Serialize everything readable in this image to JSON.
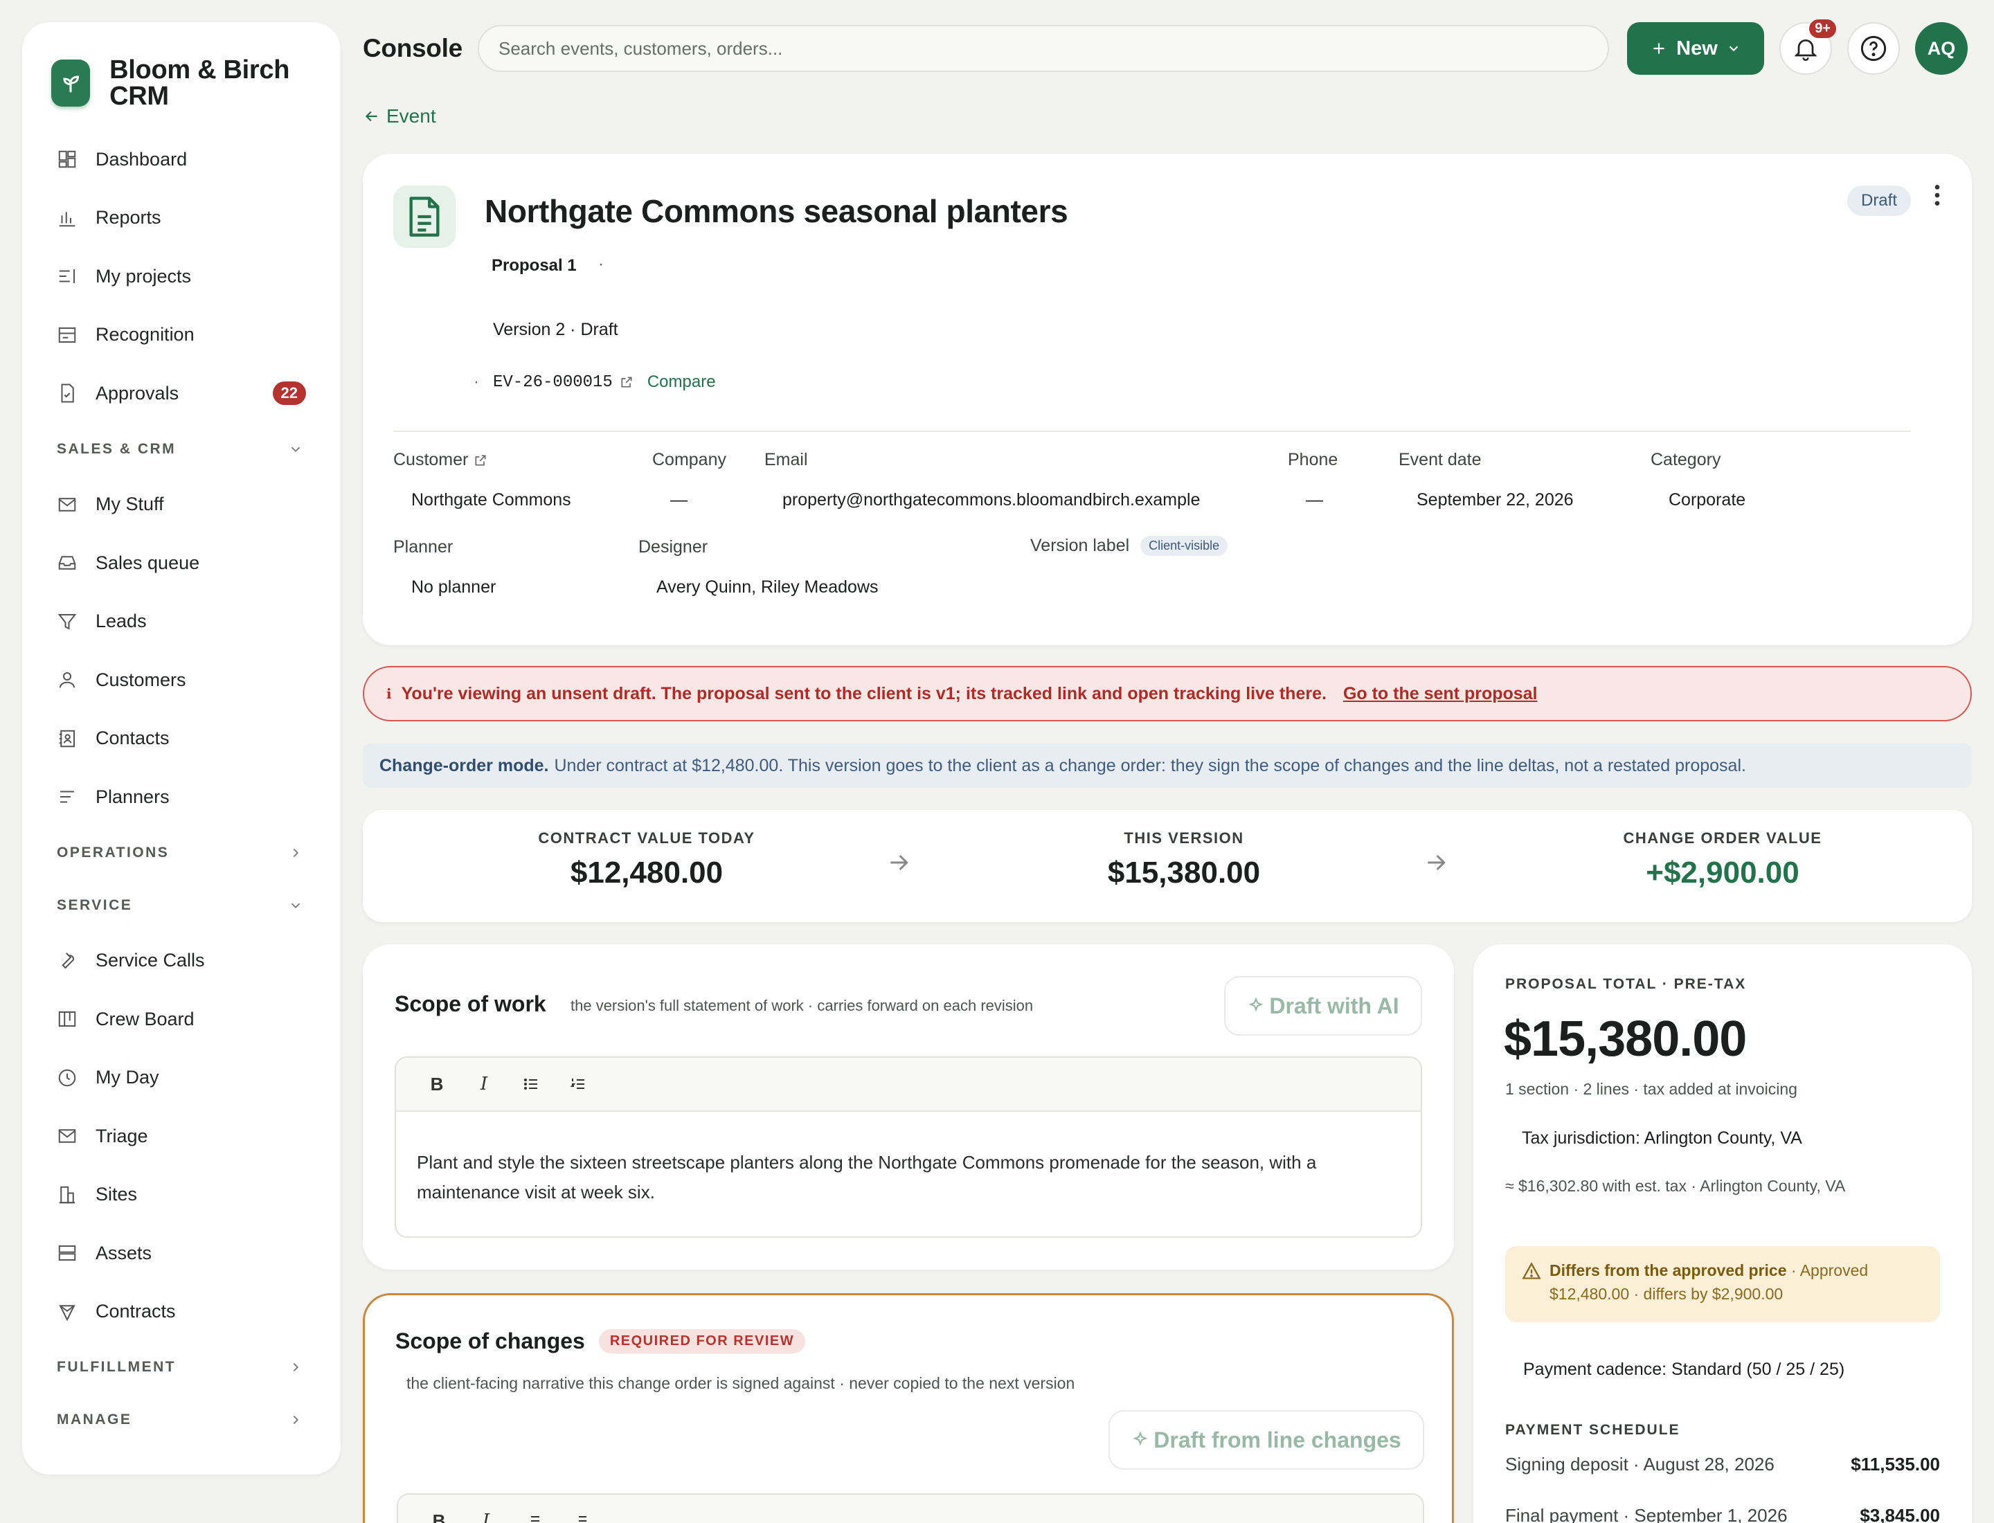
{
  "brand": {
    "name": "Bloom & Birch CRM",
    "logo_icon": "sprout-icon",
    "accent": "#22724b"
  },
  "sidebar": {
    "top_items": [
      {
        "label": "Dashboard",
        "icon": "dashboard-icon"
      },
      {
        "label": "Reports",
        "icon": "bar-chart-icon"
      },
      {
        "label": "My projects",
        "icon": "list-icon"
      },
      {
        "label": "Recognition",
        "icon": "card-icon"
      },
      {
        "label": "Approvals",
        "icon": "document-check-icon",
        "badge": "22"
      }
    ],
    "sales_section": "SALES & CRM",
    "sales_items": [
      {
        "label": "My Stuff",
        "icon": "mail-icon"
      },
      {
        "label": "Sales queue",
        "icon": "inbox-icon"
      },
      {
        "label": "Leads",
        "icon": "funnel-icon"
      },
      {
        "label": "Customers",
        "icon": "person-icon"
      },
      {
        "label": "Contacts",
        "icon": "contact-book-icon"
      },
      {
        "label": "Planners",
        "icon": "lines-icon"
      }
    ],
    "operations_section": "OPERATIONS",
    "service_section": "SERVICE",
    "service_items": [
      {
        "label": "Service Calls",
        "icon": "wrench-icon"
      },
      {
        "label": "Crew Board",
        "icon": "board-icon"
      },
      {
        "label": "My Day",
        "icon": "clock-icon"
      },
      {
        "label": "Triage",
        "icon": "mail-icon"
      },
      {
        "label": "Sites",
        "icon": "building-icon"
      },
      {
        "label": "Assets",
        "icon": "storage-icon"
      },
      {
        "label": "Contracts",
        "icon": "shield-icon"
      }
    ],
    "fulfillment_section": "FULFILLMENT",
    "manage_section": "MANAGE"
  },
  "topbar": {
    "title": "Console",
    "search_placeholder": "Search events, customers, orders...",
    "new_label": "New",
    "notif_badge": "9+",
    "avatar_initials": "AQ"
  },
  "back_link": "Event",
  "header": {
    "title": "Northgate Commons seasonal planters",
    "status": "Draft",
    "proposal_label": "Proposal 1",
    "proposal_dot": "·",
    "version": "Version 2 · Draft",
    "ref_dot": "·",
    "ref_code": "EV-26-000015",
    "compare": "Compare",
    "fields": {
      "customer_label": "Customer",
      "customer": "Northgate Commons",
      "company_label": "Company",
      "company": "—",
      "email_label": "Email",
      "email": "property@northgatecommons.bloomandbirch.example",
      "phone_label": "Phone",
      "phone": "—",
      "event_date_label": "Event date",
      "event_date": "September 22, 2026",
      "category_label": "Category",
      "category": "Corporate",
      "planner_label": "Planner",
      "planner": "No planner",
      "designer_label": "Designer",
      "designer": "Avery Quinn, Riley Meadows",
      "version_label_label": "Version label",
      "version_label_chip": "Client-visible"
    }
  },
  "alerts": {
    "draft_text": "You're viewing an unsent draft. The proposal sent to the client is v1; its tracked link and open tracking live there.",
    "draft_link": "Go to the sent proposal",
    "change_order_bold": "Change-order mode.",
    "change_order_text": "Under contract at $12,480.00. This version goes to the client as a change order: they sign the scope of changes and the line deltas, not a restated proposal."
  },
  "summary": {
    "contract_label": "CONTRACT VALUE TODAY",
    "contract_value": "$12,480.00",
    "version_label": "THIS VERSION",
    "version_value": "$15,380.00",
    "change_label": "CHANGE ORDER VALUE",
    "change_value": "+$2,900.00"
  },
  "scope": {
    "title": "Scope of work",
    "subtitle": "the version's full statement of work · carries forward on each revision",
    "ai_button": "Draft with AI",
    "body": "Plant and style the sixteen streetscape planters along the Northgate Commons promenade for the season, with a maintenance visit at week six."
  },
  "changes": {
    "title": "Scope of changes",
    "pill": "REQUIRED FOR REVIEW",
    "subtitle": "the client-facing narrative this change order is signed against · never copied to the next version",
    "ai_button": "Draft from line changes"
  },
  "total": {
    "label": "PROPOSAL TOTAL · PRE-TAX",
    "value": "$15,380.00",
    "meta": "1 section · 2 lines · tax added at invoicing",
    "tax": "Tax jurisdiction: Arlington County, VA",
    "est": "≈ $16,302.80 with est. tax · Arlington County, VA",
    "warn_bold": "Differs from the approved price",
    "warn_text": "· Approved $12,480.00 · differs by $2,900.00",
    "cadence": "Payment cadence: Standard (50 / 25 / 25)",
    "schedule_label": "PAYMENT SCHEDULE",
    "schedule": [
      {
        "label": "Signing deposit · August 28, 2026",
        "amount": "$11,535.00"
      },
      {
        "label": "Final payment · September 1, 2026",
        "amount": "$3,845.00"
      }
    ]
  }
}
